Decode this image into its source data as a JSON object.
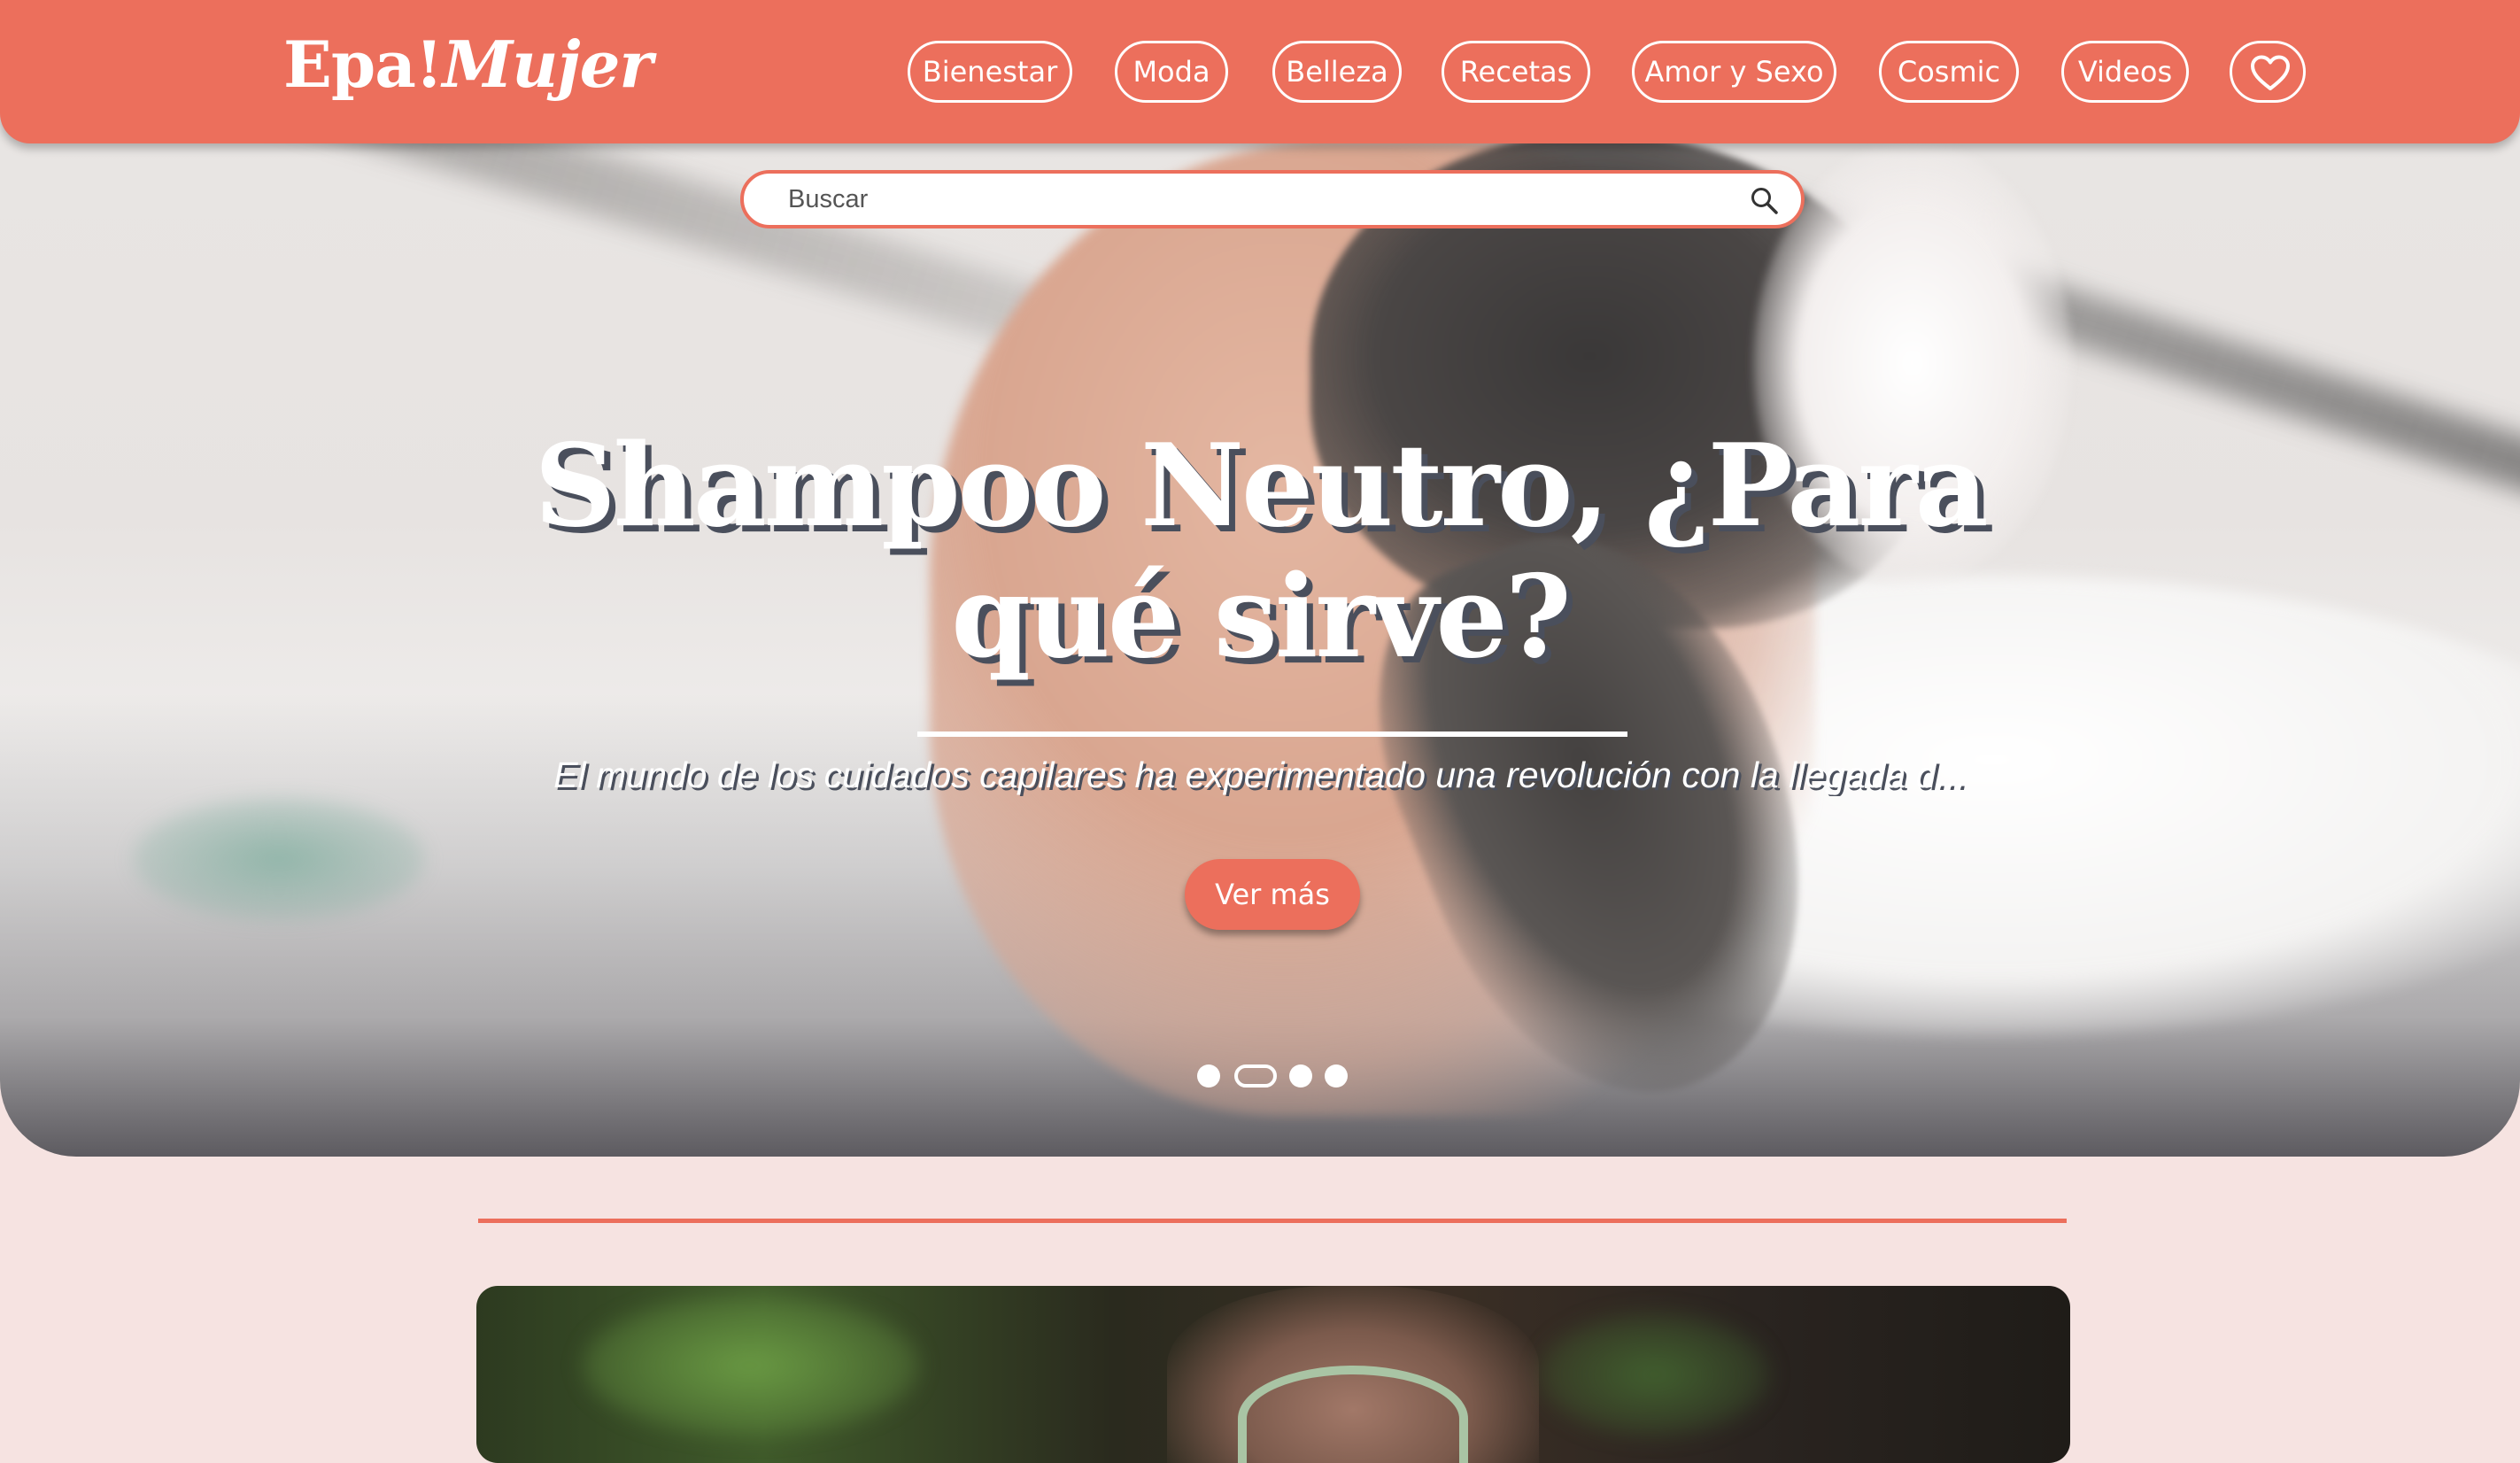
{
  "header": {
    "logo_part1": "Epa!",
    "logo_part2": "Mujer",
    "nav": [
      {
        "label": "Bienestar"
      },
      {
        "label": "Moda"
      },
      {
        "label": "Belleza"
      },
      {
        "label": "Recetas"
      },
      {
        "label": "Amor y Sexo"
      },
      {
        "label": "Cosmic"
      },
      {
        "label": "Videos"
      }
    ],
    "favorites_icon": "heart-icon"
  },
  "search": {
    "placeholder": "Buscar",
    "icon": "search-icon"
  },
  "hero": {
    "title": "Shampoo Neutro, ¿Para qué sirve?",
    "excerpt": "El mundo de los cuidados capilares ha experimentado una revolución con la llegada d...",
    "cta_label": "Ver más",
    "slides_count": 4,
    "active_slide": 2
  },
  "colors": {
    "brand": "#ec6f5c",
    "page_background": "#f6e3e1",
    "title_shadow": "#4a4f5c"
  }
}
